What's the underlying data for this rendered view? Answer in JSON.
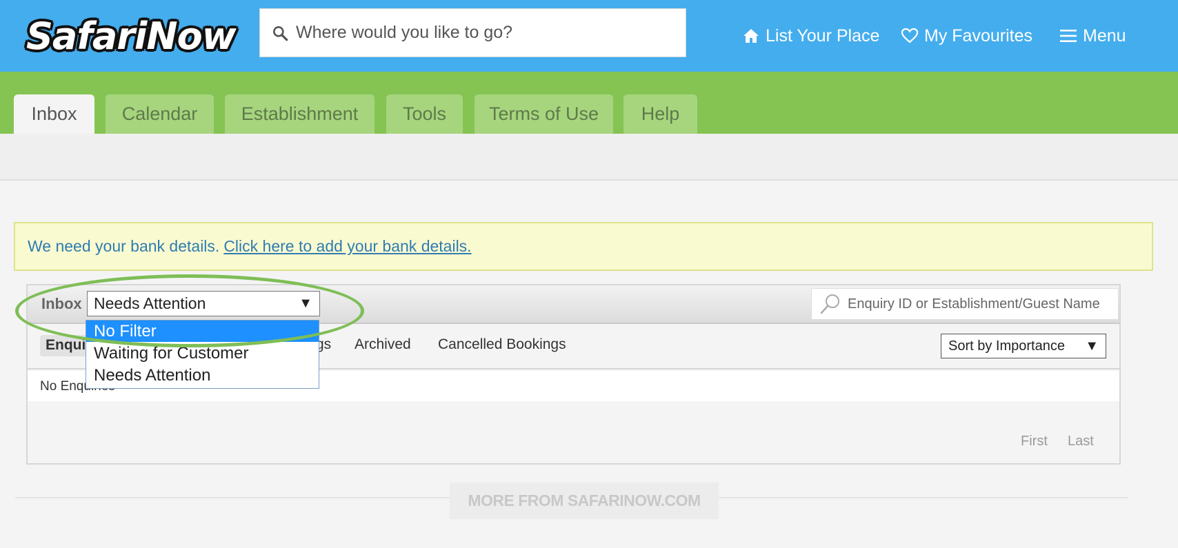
{
  "header": {
    "logo_text": "SafariNow",
    "search_placeholder": "Where would you like to go?",
    "nav": {
      "list_place": "List Your Place",
      "favourites": "My Favourites",
      "menu": "Menu"
    }
  },
  "tabs": [
    {
      "label": "Inbox"
    },
    {
      "label": "Calendar"
    },
    {
      "label": "Establishment"
    },
    {
      "label": "Tools"
    },
    {
      "label": "Terms of Use"
    },
    {
      "label": "Help"
    }
  ],
  "notice": {
    "text": "We need your bank details.",
    "link": "Click here to add your bank details."
  },
  "inbox": {
    "label": "Inbox",
    "filter_selected": "Needs Attention",
    "filter_options": [
      "No Filter",
      "Waiting for Customer",
      "Needs Attention"
    ],
    "search_placeholder": "Enquiry ID or Establishment/Guest Name",
    "subtabs": {
      "enquiries": "Enqui",
      "bookings_tail": "gs",
      "archived": "Archived",
      "cancelled": "Cancelled Bookings"
    },
    "sort_selected": "Sort by Importance",
    "empty_text": "No Enquiries",
    "pager": {
      "first": "First",
      "last": "Last"
    }
  },
  "footer": {
    "more_from": "MORE FROM SAFARINOW.COM"
  },
  "colors": {
    "header_blue": "#44adee",
    "tab_green": "#85c453",
    "link_blue": "#2e7cb2",
    "selected_option": "#1e90ff",
    "annotation_green": "#7fbe57"
  }
}
